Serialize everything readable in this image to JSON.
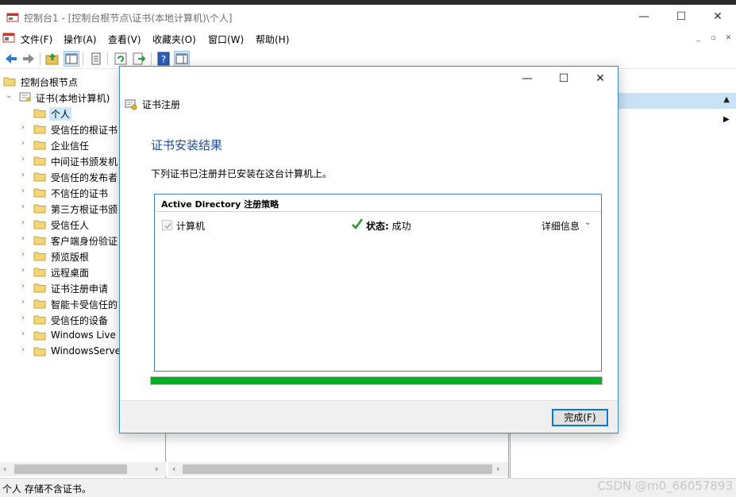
{
  "window": {
    "title": "控制台1 - [控制台根节点\\证书(本地计算机)\\个人]",
    "minimize": "—",
    "maximize": "☐",
    "close": "✕"
  },
  "menu": {
    "items": [
      "文件(F)",
      "操作(A)",
      "查看(V)",
      "收藏夹(O)",
      "窗口(W)",
      "帮助(H)"
    ],
    "mdi_minimize": "_",
    "mdi_restore": "▫",
    "mdi_close": "✕"
  },
  "toolbar": {
    "icons": [
      "back-icon",
      "forward-icon",
      "up-folder-icon",
      "show-hide-tree-icon",
      "properties-icon",
      "refresh-icon",
      "export-list-icon",
      "help-icon",
      "action-pane-icon"
    ]
  },
  "tree": {
    "root": "控制台根节点",
    "cert_store": "证书(本地计算机)",
    "items": [
      "个人",
      "受信任的根证书",
      "企业信任",
      "中间证书颁发机",
      "受信任的发布者",
      "不信任的证书",
      "第三方根证书颁",
      "受信任人",
      "客户端身份验证",
      "预览版根",
      "远程桌面",
      "证书注册申请",
      "智能卡受信任的",
      "受信任的设备",
      "Windows Live I",
      "WindowsServe"
    ]
  },
  "dialog": {
    "minimize": "—",
    "maximize": "☐",
    "close": "✕",
    "header": "证书注册",
    "heading": "证书安装结果",
    "description": "下列证书已注册并已安装在这台计算机上。",
    "policy_title": "Active Directory 注册策略",
    "row": {
      "label": "计算机",
      "status_label": "状态:",
      "status_value": "成功",
      "details": "详细信息"
    },
    "progress_fraction": 1.0,
    "finish_button": "完成(F)"
  },
  "status": {
    "text": "个人 存储不含证书。",
    "watermark": "CSDN @m0_66057893"
  },
  "colors": {
    "accent": "#0078d7",
    "heading": "#1e4e96",
    "progress": "#06b025",
    "selection": "#cce8ff"
  }
}
